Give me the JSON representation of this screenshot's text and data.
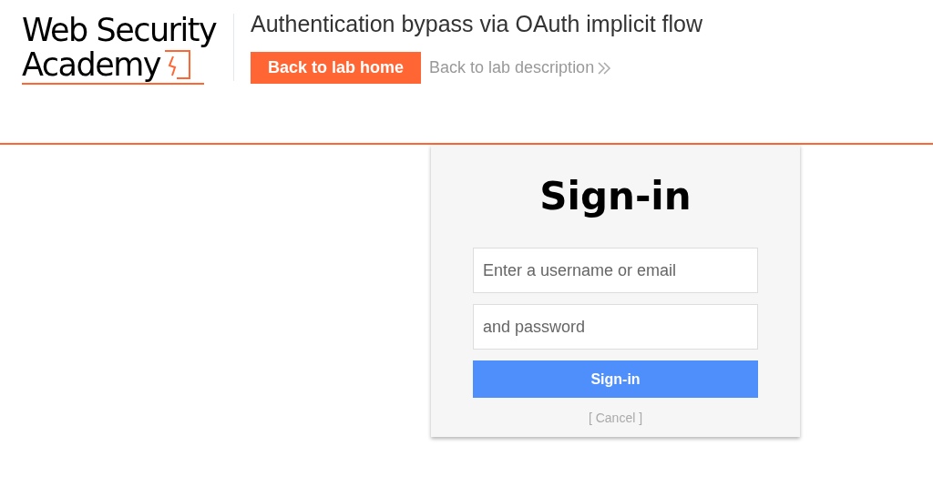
{
  "header": {
    "logo": {
      "line_1": "Web Security",
      "line_2": "Academy"
    },
    "lab_title": "Authentication bypass via OAuth implicit flow",
    "home_button": "Back to lab home",
    "description_link": "Back to lab description"
  },
  "sign_in": {
    "title": "Sign-in",
    "username": {
      "placeholder": "Enter a username or email"
    },
    "password": {
      "placeholder": "and password"
    },
    "submit": "Sign-in",
    "cancel": "[ Cancel ]"
  }
}
